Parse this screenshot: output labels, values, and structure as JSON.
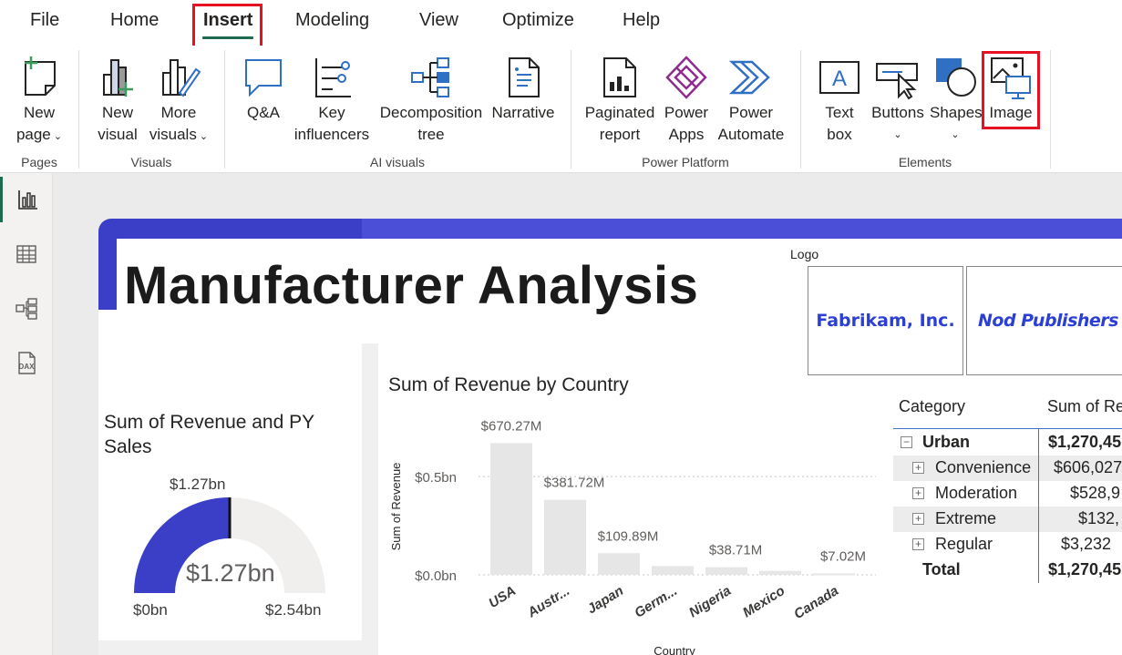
{
  "menu": {
    "items": [
      "File",
      "Home",
      "Insert",
      "Modeling",
      "View",
      "Optimize",
      "Help"
    ],
    "active": "Insert"
  },
  "ribbon": {
    "pages": {
      "new_page": [
        "New",
        "page"
      ],
      "group": "Pages"
    },
    "visuals": {
      "new_visual": [
        "New",
        "visual"
      ],
      "more_visuals": [
        "More",
        "visuals"
      ],
      "group": "Visuals"
    },
    "ai_visuals": {
      "qa": "Q&A",
      "key_influencers": [
        "Key",
        "influencers"
      ],
      "decomposition_tree": [
        "Decomposition",
        "tree"
      ],
      "narrative": "Narrative",
      "group": "AI visuals"
    },
    "power_platform": {
      "paginated_report": [
        "Paginated",
        "report"
      ],
      "power_apps": [
        "Power",
        "Apps"
      ],
      "power_automate": [
        "Power",
        "Automate"
      ],
      "group": "Power Platform"
    },
    "elements": {
      "text_box": [
        "Text",
        "box"
      ],
      "buttons": "Buttons",
      "shapes": "Shapes",
      "image": "Image",
      "group": "Elements"
    }
  },
  "colors": {
    "accent": "#1e6b52",
    "highlight": "#e81123",
    "report_blue": "#3b3fc7",
    "logo_blue": "#2b3fd6"
  },
  "leftnav": {
    "icons": [
      "report-view-icon",
      "table-view-icon",
      "model-view-icon",
      "dax-query-icon"
    ],
    "active": 0
  },
  "report": {
    "title": "Manufacturer Analysis",
    "logo_caption": "Logo",
    "logos": [
      "Fabrikam, Inc.",
      "Nod Publishers"
    ],
    "gauge": {
      "title": "Sum of Revenue and PY Sales",
      "value_label": "$1.27bn",
      "target_label": "$1.27bn",
      "min_label": "$0bn",
      "max_label": "$2.54bn",
      "value": 1.27,
      "min": 0,
      "max": 2.54
    },
    "matrix": {
      "headers": [
        "Category",
        "Sum of Re"
      ],
      "rows": [
        {
          "category": "Urban",
          "value": "$1,270,45",
          "level": 0
        },
        {
          "category": "Convenience",
          "value": "$606,027",
          "level": 1
        },
        {
          "category": "Moderation",
          "value": "$528,9",
          "level": 1
        },
        {
          "category": "Extreme",
          "value": "$132,",
          "level": 1
        },
        {
          "category": "Regular",
          "value": "$3,232",
          "level": 1
        }
      ],
      "total": {
        "label": "Total",
        "value": "$1,270,45"
      }
    }
  },
  "chart_data": {
    "type": "bar",
    "title": "Sum of Revenue by Country",
    "xlabel": "Country",
    "ylabel": "Sum of Revenue",
    "categories": [
      "USA",
      "Austr...",
      "Japan",
      "Germ...",
      "Nigeria",
      "Mexico",
      "Canada"
    ],
    "values": [
      670.27,
      381.72,
      109.89,
      45,
      38.71,
      20,
      7.02
    ],
    "value_labels": [
      "$670.27M",
      "$381.72M",
      "$109.89M",
      "",
      "$38.71M",
      "",
      "$7.02M"
    ],
    "yticks": [
      {
        "value": 0,
        "label": "$0.0bn"
      },
      {
        "value": 500,
        "label": "$0.5bn"
      }
    ],
    "ylim": [
      0,
      700
    ],
    "grid": true,
    "bar_color": "#e6e6e6"
  }
}
